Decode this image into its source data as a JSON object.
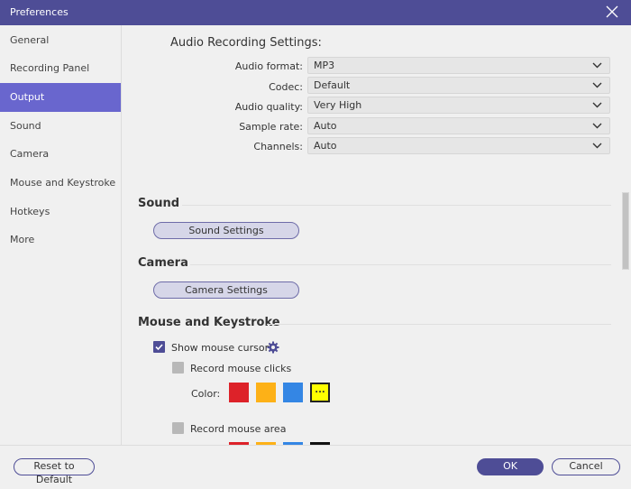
{
  "window": {
    "title": "Preferences"
  },
  "sidebar": {
    "items": [
      {
        "label": "General",
        "active": false
      },
      {
        "label": "Recording Panel",
        "active": false
      },
      {
        "label": "Output",
        "active": true
      },
      {
        "label": "Sound",
        "active": false
      },
      {
        "label": "Camera",
        "active": false
      },
      {
        "label": "Mouse and Keystroke",
        "active": false
      },
      {
        "label": "Hotkeys",
        "active": false
      },
      {
        "label": "More",
        "active": false
      }
    ]
  },
  "audio": {
    "heading": "Audio Recording Settings:",
    "fields": [
      {
        "label": "Audio format:",
        "value": "MP3"
      },
      {
        "label": "Codec:",
        "value": "Default"
      },
      {
        "label": "Audio quality:",
        "value": "Very High"
      },
      {
        "label": "Sample rate:",
        "value": "Auto"
      },
      {
        "label": "Channels:",
        "value": "Auto"
      }
    ]
  },
  "sound": {
    "heading": "Sound",
    "button": "Sound Settings"
  },
  "camera": {
    "heading": "Camera",
    "button": "Camera Settings"
  },
  "mouse": {
    "heading": "Mouse and Keystroke",
    "show_cursor": {
      "label": "Show mouse cursor",
      "checked": true
    },
    "record_clicks": {
      "label": "Record mouse clicks",
      "checked": false
    },
    "color_label": "Color:",
    "click_colors": [
      "#dd2229",
      "#fdb117",
      "#3486e4"
    ],
    "more_colors_label": "...",
    "more_colors_bg": "#ffff00",
    "record_area": {
      "label": "Record mouse area",
      "checked": false
    },
    "area_colors": [
      "#dd2229",
      "#fdb117",
      "#3486e4",
      "#111111"
    ]
  },
  "footer": {
    "reset": "Reset to Default",
    "ok": "OK",
    "cancel": "Cancel"
  },
  "colors": {
    "accent": "#4e4d96",
    "sidebar_active": "#6966ce"
  }
}
